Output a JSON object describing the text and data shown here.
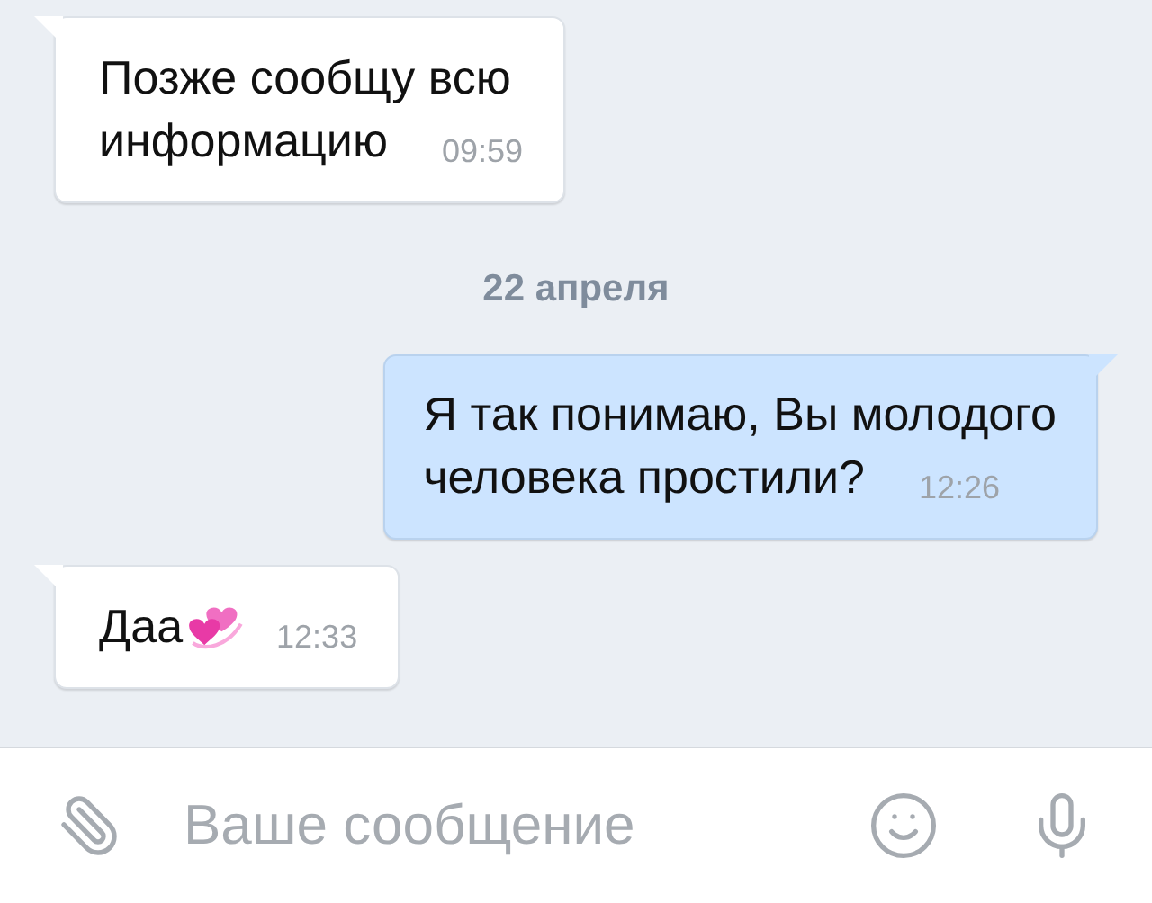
{
  "messages": [
    {
      "kind": "incoming",
      "lines": [
        "Позже сообщу всю",
        "информацию"
      ],
      "time": "09:59"
    },
    {
      "kind": "date",
      "text": "22 апреля"
    },
    {
      "kind": "outgoing",
      "lines": [
        "Я так понимаю, Вы молодого",
        "человека простили?"
      ],
      "time": "12:26"
    },
    {
      "kind": "incoming",
      "lines": [
        "Даа"
      ],
      "time": "12:33",
      "has_emoji": true
    }
  ],
  "composer": {
    "placeholder": "Ваше сообщение"
  }
}
